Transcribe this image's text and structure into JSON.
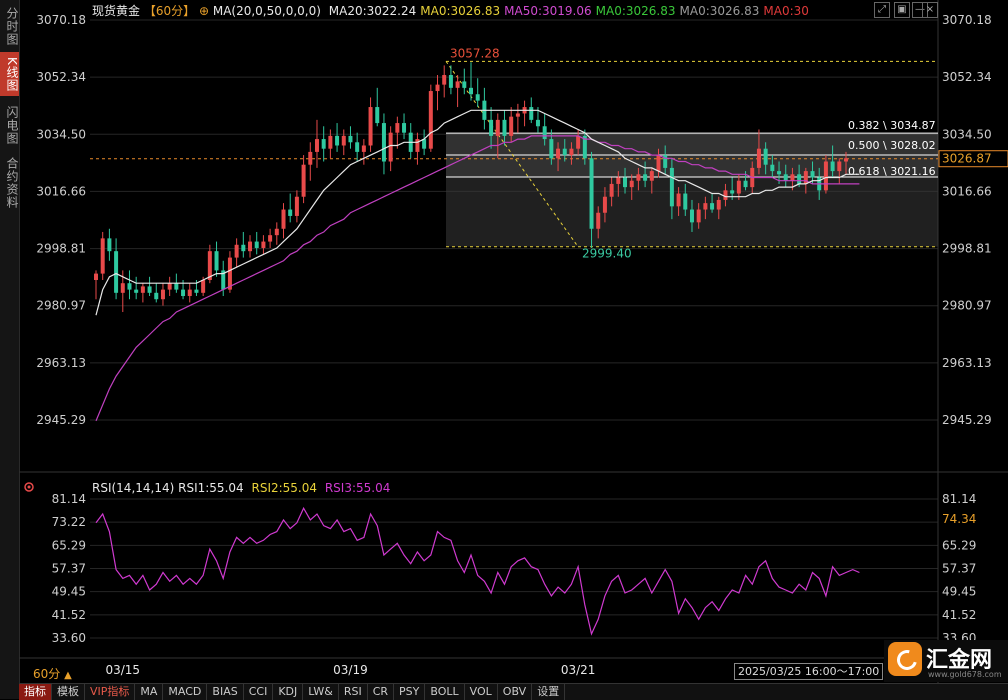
{
  "left_tabs": [
    {
      "label": "分时图",
      "active": false
    },
    {
      "label": "K线图",
      "active": true
    },
    {
      "label": "闪电图",
      "active": false
    },
    {
      "label": "合约资料",
      "active": false
    }
  ],
  "header": {
    "symbol": "现货黄金",
    "period": "【60分】",
    "settings_icon": "gear-icon",
    "ma_params": "MA(20,0,50,0,0,0)",
    "legend": [
      {
        "text": "MA20:3022.24",
        "color": "#e8e8e8"
      },
      {
        "text": "MA0:3026.83",
        "color": "#e8d23a"
      },
      {
        "text": "MA50:3019.06",
        "color": "#d04bd0"
      },
      {
        "text": "MA0:3026.83",
        "color": "#3ac83a"
      },
      {
        "text": "MA0:3026.83",
        "color": "#9a9a9a"
      },
      {
        "text": "MA0:30",
        "color": "#e03a3a"
      }
    ],
    "window_icons": [
      "restore-icon",
      "expand-icon",
      "minimize-icon",
      "close-icon"
    ]
  },
  "price_axis_labels": [
    "3070.18",
    "3052.34",
    "3034.50",
    "3016.66",
    "2998.81",
    "2980.97",
    "2963.13",
    "2945.29"
  ],
  "rsi_axis_labels": [
    "81.14",
    "73.22",
    "65.29",
    "57.37",
    "49.45",
    "41.52",
    "33.60"
  ],
  "rsi_right_extra": "73.22",
  "current_price": "3026.87",
  "current_rsi": "74.34",
  "fib": {
    "high_label": "3057.28",
    "low_label": "2999.40",
    "levels": [
      "0.382 \\ 3034.87",
      "0.500 \\ 3028.02",
      "0.618 \\ 3021.16"
    ]
  },
  "rsi_header": {
    "params": "RSI(14,14,14)",
    "rsi1": "RSI1:55.04",
    "rsi2": "RSI2:55.04",
    "rsi3": "RSI3:55.04"
  },
  "x_axis_dates": [
    "03/15",
    "03/19",
    "03/21",
    "03/25"
  ],
  "period_label": "60分",
  "time_range": "2025/03/25 16:00～17:00",
  "bottom_tabs": [
    "指标",
    "模板",
    "VIP指标",
    "MA",
    "MACD",
    "BIAS",
    "CCI",
    "KDJ",
    "LW&",
    "RSI",
    "CR",
    "PSY",
    "BOLL",
    "VOL",
    "OBV",
    "设置"
  ],
  "logo": {
    "name": "汇金网",
    "url": "www.gold678.com"
  },
  "colors": {
    "up": "#e84a4a",
    "down": "#2fc9a0",
    "ma20": "#e8e8e8",
    "ma50": "#c040c0",
    "fib": "#e8d23a",
    "rsi": "#d03ad0",
    "price_ref": "#e88a2a"
  },
  "chart_data": {
    "type": "candlestick",
    "title": "现货黄金 60分",
    "ylim": [
      2940,
      3072
    ],
    "rsi_ylim": [
      28,
      84
    ],
    "x_date_ticks": [
      "03/15",
      "03/19",
      "03/21",
      "03/25"
    ],
    "candles": [
      {
        "o": 2989,
        "h": 2992,
        "l": 2983,
        "c": 2991
      },
      {
        "o": 2991,
        "h": 3004,
        "l": 2989,
        "c": 3002
      },
      {
        "o": 3002,
        "h": 3005,
        "l": 2995,
        "c": 2998
      },
      {
        "o": 2998,
        "h": 3002,
        "l": 2983,
        "c": 2985
      },
      {
        "o": 2985,
        "h": 2992,
        "l": 2979,
        "c": 2988
      },
      {
        "o": 2988,
        "h": 2992,
        "l": 2983,
        "c": 2986
      },
      {
        "o": 2986,
        "h": 2990,
        "l": 2983,
        "c": 2985
      },
      {
        "o": 2985,
        "h": 2988,
        "l": 2982,
        "c": 2987
      },
      {
        "o": 2987,
        "h": 2990,
        "l": 2984,
        "c": 2985
      },
      {
        "o": 2985,
        "h": 2988,
        "l": 2982,
        "c": 2983
      },
      {
        "o": 2983,
        "h": 2988,
        "l": 2981,
        "c": 2986
      },
      {
        "o": 2986,
        "h": 2990,
        "l": 2984,
        "c": 2988
      },
      {
        "o": 2988,
        "h": 2991,
        "l": 2985,
        "c": 2986
      },
      {
        "o": 2986,
        "h": 2989,
        "l": 2983,
        "c": 2984
      },
      {
        "o": 2984,
        "h": 2988,
        "l": 2982,
        "c": 2986
      },
      {
        "o": 2986,
        "h": 2989,
        "l": 2984,
        "c": 2985
      },
      {
        "o": 2985,
        "h": 2990,
        "l": 2984,
        "c": 2989
      },
      {
        "o": 2989,
        "h": 3000,
        "l": 2988,
        "c": 2998
      },
      {
        "o": 2998,
        "h": 3001,
        "l": 2990,
        "c": 2992
      },
      {
        "o": 2992,
        "h": 2995,
        "l": 2984,
        "c": 2986
      },
      {
        "o": 2986,
        "h": 2998,
        "l": 2985,
        "c": 2996
      },
      {
        "o": 2996,
        "h": 3002,
        "l": 2993,
        "c": 3000
      },
      {
        "o": 3000,
        "h": 3004,
        "l": 2996,
        "c": 2998
      },
      {
        "o": 2998,
        "h": 3003,
        "l": 2996,
        "c": 3001
      },
      {
        "o": 3001,
        "h": 3004,
        "l": 2997,
        "c": 2999
      },
      {
        "o": 2999,
        "h": 3003,
        "l": 2997,
        "c": 3001
      },
      {
        "o": 3001,
        "h": 3005,
        "l": 2999,
        "c": 3003
      },
      {
        "o": 3003,
        "h": 3007,
        "l": 3000,
        "c": 3005
      },
      {
        "o": 3005,
        "h": 3013,
        "l": 3002,
        "c": 3011
      },
      {
        "o": 3011,
        "h": 3016,
        "l": 3007,
        "c": 3009
      },
      {
        "o": 3009,
        "h": 3017,
        "l": 3007,
        "c": 3015
      },
      {
        "o": 3015,
        "h": 3028,
        "l": 3013,
        "c": 3025
      },
      {
        "o": 3025,
        "h": 3032,
        "l": 3020,
        "c": 3029
      },
      {
        "o": 3029,
        "h": 3039,
        "l": 3024,
        "c": 3033
      },
      {
        "o": 3033,
        "h": 3037,
        "l": 3026,
        "c": 3030
      },
      {
        "o": 3030,
        "h": 3036,
        "l": 3027,
        "c": 3034
      },
      {
        "o": 3034,
        "h": 3038,
        "l": 3029,
        "c": 3031
      },
      {
        "o": 3031,
        "h": 3036,
        "l": 3028,
        "c": 3034
      },
      {
        "o": 3034,
        "h": 3037,
        "l": 3030,
        "c": 3032
      },
      {
        "o": 3032,
        "h": 3035,
        "l": 3026,
        "c": 3029
      },
      {
        "o": 3029,
        "h": 3033,
        "l": 3025,
        "c": 3031
      },
      {
        "o": 3031,
        "h": 3046,
        "l": 3029,
        "c": 3043
      },
      {
        "o": 3043,
        "h": 3049,
        "l": 3037,
        "c": 3038
      },
      {
        "o": 3038,
        "h": 3041,
        "l": 3022,
        "c": 3026
      },
      {
        "o": 3026,
        "h": 3037,
        "l": 3023,
        "c": 3035
      },
      {
        "o": 3035,
        "h": 3040,
        "l": 3030,
        "c": 3038
      },
      {
        "o": 3038,
        "h": 3041,
        "l": 3033,
        "c": 3035
      },
      {
        "o": 3035,
        "h": 3038,
        "l": 3027,
        "c": 3029
      },
      {
        "o": 3029,
        "h": 3035,
        "l": 3025,
        "c": 3033
      },
      {
        "o": 3033,
        "h": 3036,
        "l": 3028,
        "c": 3030
      },
      {
        "o": 3030,
        "h": 3050,
        "l": 3029,
        "c": 3048
      },
      {
        "o": 3048,
        "h": 3053,
        "l": 3042,
        "c": 3050
      },
      {
        "o": 3050,
        "h": 3056,
        "l": 3046,
        "c": 3053
      },
      {
        "o": 3053,
        "h": 3056,
        "l": 3047,
        "c": 3049
      },
      {
        "o": 3049,
        "h": 3053,
        "l": 3043,
        "c": 3051
      },
      {
        "o": 3051,
        "h": 3055,
        "l": 3047,
        "c": 3049
      },
      {
        "o": 3049,
        "h": 3057,
        "l": 3045,
        "c": 3047
      },
      {
        "o": 3047,
        "h": 3052,
        "l": 3043,
        "c": 3045
      },
      {
        "o": 3045,
        "h": 3049,
        "l": 3036,
        "c": 3039
      },
      {
        "o": 3039,
        "h": 3043,
        "l": 3030,
        "c": 3034
      },
      {
        "o": 3034,
        "h": 3041,
        "l": 3027,
        "c": 3039
      },
      {
        "o": 3039,
        "h": 3042,
        "l": 3031,
        "c": 3034
      },
      {
        "o": 3034,
        "h": 3043,
        "l": 3032,
        "c": 3040
      },
      {
        "o": 3040,
        "h": 3044,
        "l": 3035,
        "c": 3041
      },
      {
        "o": 3041,
        "h": 3045,
        "l": 3037,
        "c": 3043
      },
      {
        "o": 3043,
        "h": 3046,
        "l": 3038,
        "c": 3039
      },
      {
        "o": 3039,
        "h": 3043,
        "l": 3035,
        "c": 3037
      },
      {
        "o": 3037,
        "h": 3041,
        "l": 3031,
        "c": 3033
      },
      {
        "o": 3033,
        "h": 3036,
        "l": 3025,
        "c": 3027
      },
      {
        "o": 3027,
        "h": 3032,
        "l": 3023,
        "c": 3030
      },
      {
        "o": 3030,
        "h": 3033,
        "l": 3026,
        "c": 3028
      },
      {
        "o": 3028,
        "h": 3032,
        "l": 3025,
        "c": 3030
      },
      {
        "o": 3030,
        "h": 3036,
        "l": 3028,
        "c": 3034
      },
      {
        "o": 3034,
        "h": 3036,
        "l": 3025,
        "c": 3027
      },
      {
        "o": 3027,
        "h": 3029,
        "l": 2999,
        "c": 3005
      },
      {
        "o": 3005,
        "h": 3012,
        "l": 3002,
        "c": 3010
      },
      {
        "o": 3010,
        "h": 3018,
        "l": 3007,
        "c": 3015
      },
      {
        "o": 3015,
        "h": 3021,
        "l": 3012,
        "c": 3019
      },
      {
        "o": 3019,
        "h": 3023,
        "l": 3015,
        "c": 3021
      },
      {
        "o": 3021,
        "h": 3024,
        "l": 3016,
        "c": 3018
      },
      {
        "o": 3018,
        "h": 3022,
        "l": 3014,
        "c": 3020
      },
      {
        "o": 3020,
        "h": 3024,
        "l": 3017,
        "c": 3022
      },
      {
        "o": 3022,
        "h": 3026,
        "l": 3018,
        "c": 3020
      },
      {
        "o": 3020,
        "h": 3024,
        "l": 3016,
        "c": 3023
      },
      {
        "o": 3023,
        "h": 3030,
        "l": 3021,
        "c": 3028
      },
      {
        "o": 3028,
        "h": 3031,
        "l": 3022,
        "c": 3024
      },
      {
        "o": 3024,
        "h": 3027,
        "l": 3008,
        "c": 3012
      },
      {
        "o": 3012,
        "h": 3018,
        "l": 3009,
        "c": 3016
      },
      {
        "o": 3016,
        "h": 3019,
        "l": 3009,
        "c": 3011
      },
      {
        "o": 3011,
        "h": 3014,
        "l": 3004,
        "c": 3007
      },
      {
        "o": 3007,
        "h": 3013,
        "l": 3005,
        "c": 3011
      },
      {
        "o": 3011,
        "h": 3015,
        "l": 3008,
        "c": 3013
      },
      {
        "o": 3013,
        "h": 3016,
        "l": 3010,
        "c": 3011
      },
      {
        "o": 3011,
        "h": 3015,
        "l": 3008,
        "c": 3014
      },
      {
        "o": 3014,
        "h": 3019,
        "l": 3012,
        "c": 3017
      },
      {
        "o": 3017,
        "h": 3021,
        "l": 3014,
        "c": 3016
      },
      {
        "o": 3016,
        "h": 3022,
        "l": 3014,
        "c": 3020
      },
      {
        "o": 3020,
        "h": 3023,
        "l": 3017,
        "c": 3018
      },
      {
        "o": 3018,
        "h": 3026,
        "l": 3016,
        "c": 3024
      },
      {
        "o": 3024,
        "h": 3036,
        "l": 3022,
        "c": 3030
      },
      {
        "o": 3030,
        "h": 3032,
        "l": 3022,
        "c": 3025
      },
      {
        "o": 3025,
        "h": 3028,
        "l": 3021,
        "c": 3023
      },
      {
        "o": 3023,
        "h": 3026,
        "l": 3019,
        "c": 3022
      },
      {
        "o": 3022,
        "h": 3025,
        "l": 3018,
        "c": 3020
      },
      {
        "o": 3020,
        "h": 3024,
        "l": 3017,
        "c": 3022
      },
      {
        "o": 3022,
        "h": 3025,
        "l": 3018,
        "c": 3019
      },
      {
        "o": 3019,
        "h": 3024,
        "l": 3016,
        "c": 3023
      },
      {
        "o": 3023,
        "h": 3026,
        "l": 3019,
        "c": 3021
      },
      {
        "o": 3021,
        "h": 3024,
        "l": 3014,
        "c": 3017
      },
      {
        "o": 3017,
        "h": 3028,
        "l": 3016,
        "c": 3026
      },
      {
        "o": 3026,
        "h": 3031,
        "l": 3021,
        "c": 3023
      },
      {
        "o": 3023,
        "h": 3027,
        "l": 3019,
        "c": 3026
      },
      {
        "o": 3026,
        "h": 3029,
        "l": 3022,
        "c": 3027
      }
    ],
    "ma20": [
      2978,
      2986,
      2990,
      2991,
      2990,
      2989,
      2988,
      2988,
      2988,
      2988,
      2988,
      2988,
      2988,
      2988,
      2988,
      2988,
      2989,
      2990,
      2991,
      2991,
      2992,
      2993,
      2994,
      2995,
      2996,
      2997,
      2998,
      2999,
      3001,
      3003,
      3005,
      3008,
      3011,
      3014,
      3017,
      3019,
      3021,
      3023,
      3025,
      3026,
      3027,
      3028,
      3029,
      3030,
      3031,
      3031,
      3032,
      3032,
      3032,
      3033,
      3035,
      3036,
      3038,
      3039,
      3040,
      3041,
      3042,
      3042,
      3042,
      3042,
      3042,
      3042,
      3042,
      3042,
      3042,
      3042,
      3042,
      3041,
      3040,
      3039,
      3038,
      3037,
      3036,
      3035,
      3033,
      3032,
      3031,
      3030,
      3029,
      3027,
      3026,
      3025,
      3024,
      3024,
      3023,
      3022,
      3021,
      3020,
      3020,
      3019,
      3018,
      3017,
      3016,
      3016,
      3015,
      3015,
      3015,
      3015,
      3016,
      3016,
      3017,
      3017,
      3018,
      3018,
      3018,
      3019,
      3019,
      3020,
      3020,
      3021,
      3021,
      3021,
      3022,
      3022,
      3022
    ],
    "ma50": [
      2945,
      2950,
      2955,
      2959,
      2962,
      2965,
      2968,
      2970,
      2972,
      2974,
      2976,
      2977,
      2979,
      2980,
      2981,
      2982,
      2983,
      2984,
      2985,
      2986,
      2987,
      2988,
      2989,
      2990,
      2991,
      2992,
      2993,
      2994,
      2995,
      2997,
      2998,
      3000,
      3001,
      3003,
      3004,
      3006,
      3007,
      3008,
      3010,
      3011,
      3012,
      3013,
      3014,
      3015,
      3016,
      3017,
      3018,
      3019,
      3020,
      3021,
      3022,
      3023,
      3024,
      3025,
      3026,
      3027,
      3028,
      3029,
      3030,
      3031,
      3031,
      3032,
      3032,
      3033,
      3033,
      3034,
      3034,
      3034,
      3034,
      3034,
      3034,
      3034,
      3034,
      3033,
      3033,
      3032,
      3032,
      3031,
      3031,
      3030,
      3030,
      3029,
      3029,
      3028,
      3028,
      3027,
      3027,
      3026,
      3026,
      3025,
      3025,
      3024,
      3024,
      3023,
      3023,
      3022,
      3022,
      3022,
      3021,
      3021,
      3021,
      3021,
      3020,
      3020,
      3020,
      3020,
      3020,
      3019,
      3019,
      3019,
      3019,
      3019,
      3019,
      3019,
      3019
    ],
    "rsi": [
      73,
      76,
      70,
      57,
      54,
      55,
      52,
      55,
      50,
      52,
      56,
      53,
      55,
      52,
      54,
      52,
      55,
      64,
      60,
      54,
      63,
      68,
      66,
      68,
      66,
      67,
      69,
      70,
      74,
      71,
      73,
      78,
      74,
      76,
      72,
      71,
      74,
      70,
      71,
      67,
      68,
      76,
      72,
      62,
      64,
      66,
      62,
      59,
      63,
      60,
      62,
      70,
      68,
      67,
      60,
      56,
      62,
      55,
      53,
      49,
      56,
      52,
      58,
      60,
      61,
      58,
      57,
      52,
      48,
      51,
      49,
      52,
      58,
      45,
      35,
      40,
      48,
      53,
      55,
      49,
      50,
      52,
      54,
      49,
      53,
      57,
      53,
      42,
      47,
      44,
      40,
      44,
      46,
      43,
      47,
      50,
      49,
      55,
      52,
      58,
      60,
      54,
      51,
      50,
      49,
      52,
      50,
      56,
      54,
      48,
      58,
      55,
      56,
      57,
      56
    ],
    "fib_levels": [
      {
        "ratio": 0.382,
        "price": 3034.87
      },
      {
        "ratio": 0.5,
        "price": 3028.02
      },
      {
        "ratio": 0.618,
        "price": 3021.16
      }
    ],
    "fib_high": 3057.28,
    "fib_low": 2999.4,
    "last_price": 3026.87,
    "last_rsi": 74.34
  }
}
